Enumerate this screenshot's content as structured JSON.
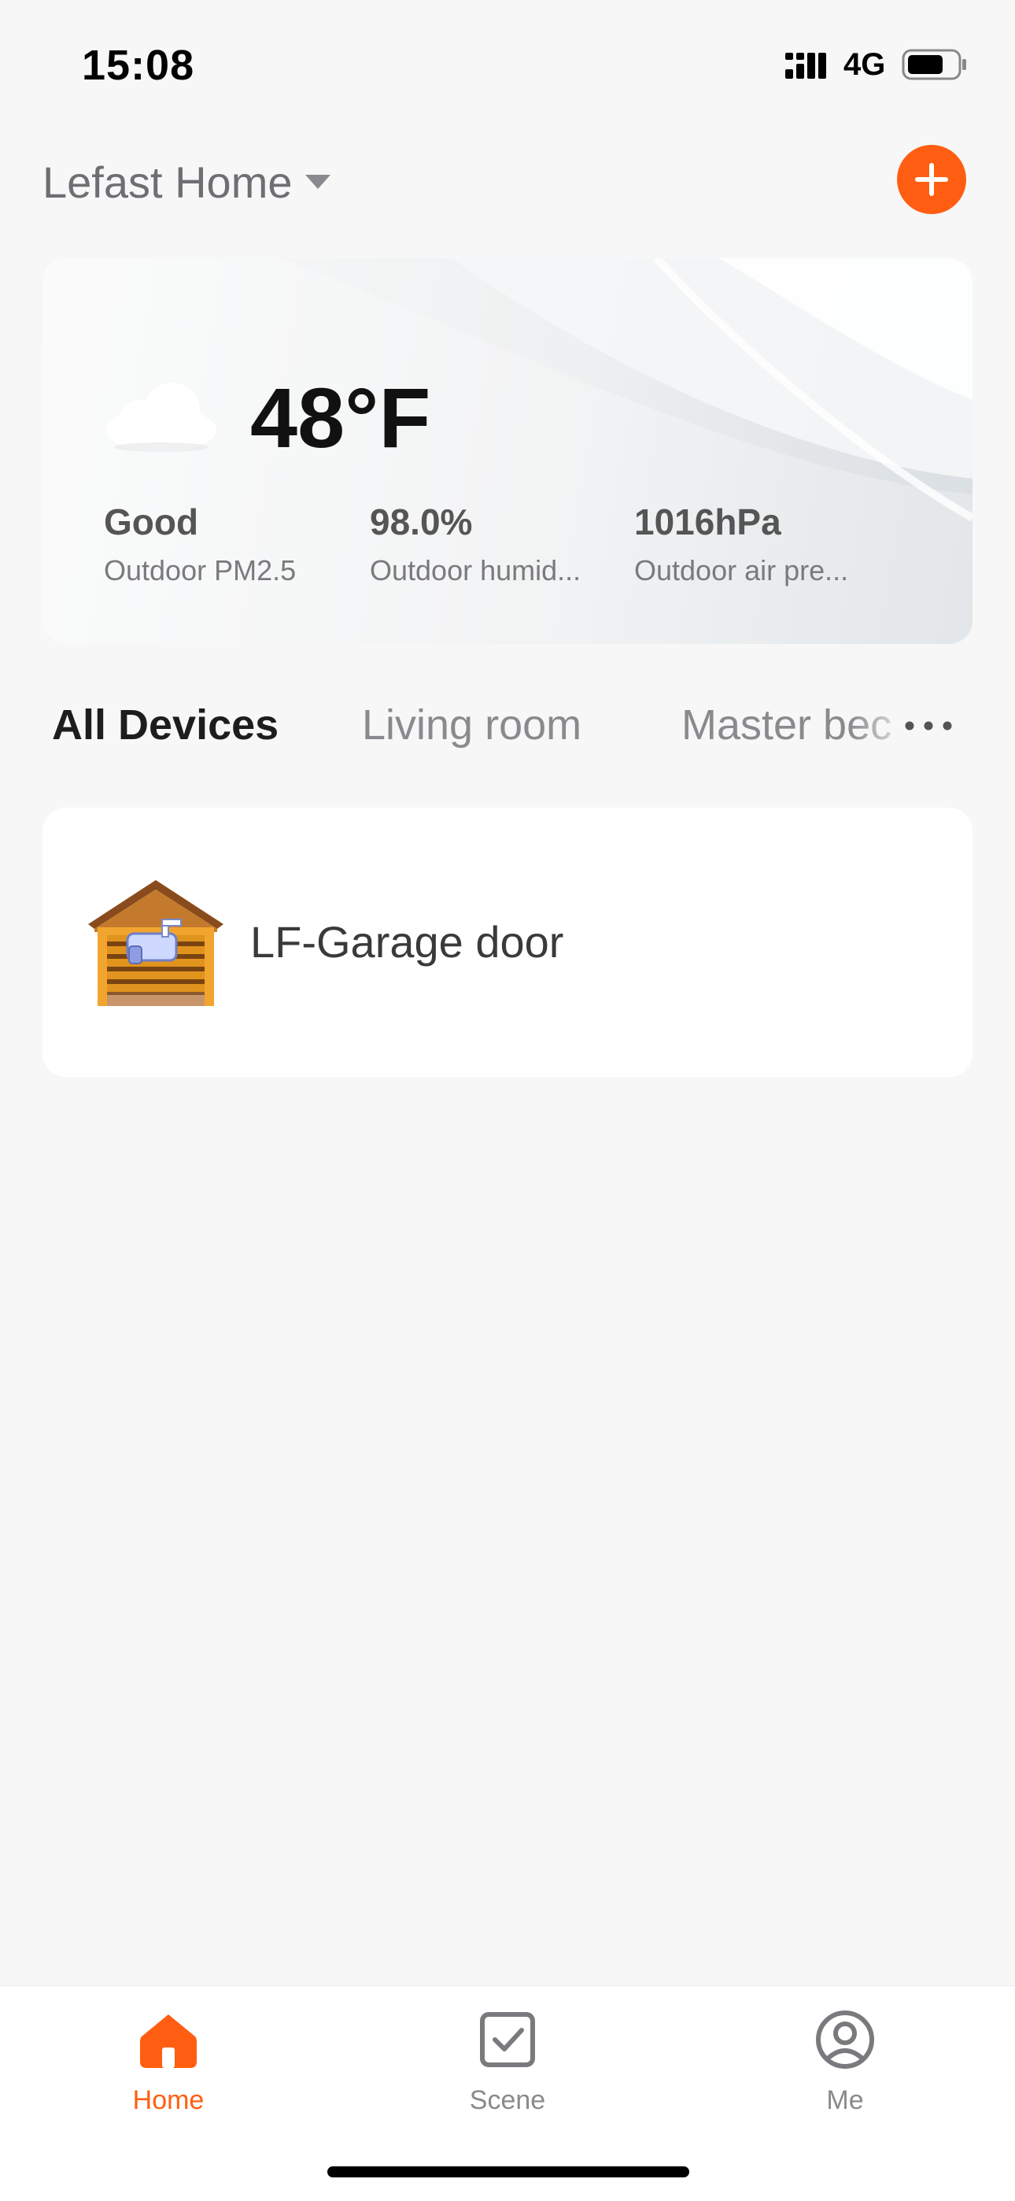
{
  "status_bar": {
    "time": "15:08",
    "network": "4G",
    "icons": [
      "signal-icon",
      "battery-icon"
    ]
  },
  "header": {
    "home_name": "Lefast Home",
    "dropdown_icon": "caret-down-icon",
    "add_icon": "plus-icon"
  },
  "weather": {
    "icon": "cloud-icon",
    "temperature": "48°F",
    "stats": [
      {
        "value": "Good",
        "label": "Outdoor PM2.5"
      },
      {
        "value": "98.0%",
        "label": "Outdoor humid..."
      },
      {
        "value": "1016hPa",
        "label": "Outdoor air pre..."
      }
    ]
  },
  "rooms": {
    "tabs": [
      {
        "label": "All Devices",
        "active": true
      },
      {
        "label": "Living room",
        "active": false
      },
      {
        "label": "Master bec",
        "active": false
      }
    ],
    "more_icon": "more-dots-icon"
  },
  "devices": [
    {
      "name": "LF-Garage door",
      "icon": "garage-door-icon"
    }
  ],
  "bottom_nav": {
    "items": [
      {
        "label": "Home",
        "icon": "home-icon",
        "active": true
      },
      {
        "label": "Scene",
        "icon": "scene-checkbox-icon",
        "active": false
      },
      {
        "label": "Me",
        "icon": "profile-icon",
        "active": false
      }
    ]
  },
  "colors": {
    "accent": "#ff5e12",
    "background": "#f7f7f8",
    "card": "#ffffff",
    "text_primary": "#1d1d1f",
    "text_secondary": "#8a8a8e"
  }
}
